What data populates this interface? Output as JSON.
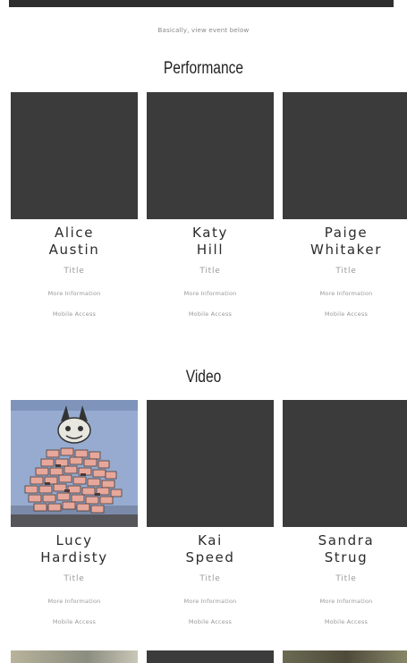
{
  "intro_text": "Basically, view event below",
  "sections": [
    {
      "title": "Performance",
      "artists": [
        {
          "first": "Alice",
          "last": "Austin",
          "title": "Title",
          "more": "More Information",
          "mobile": "Mobile Access"
        },
        {
          "first": "Katy",
          "last": "Hill",
          "title": "Title",
          "more": "More Information",
          "mobile": "Mobile Access"
        },
        {
          "first": "Paige",
          "last": "Whitaker",
          "title": "Title",
          "more": "More Information",
          "mobile": "Mobile Access"
        }
      ]
    },
    {
      "title": "Video",
      "artists": [
        {
          "first": "Lucy",
          "last": "Hardisty",
          "title": "Title",
          "more": "More Information",
          "mobile": "Mobile Access"
        },
        {
          "first": "Kai",
          "last": "Speed",
          "title": "Title",
          "more": "More Information",
          "mobile": "Mobile Access"
        },
        {
          "first": "Sandra",
          "last": "Strug",
          "title": "Title",
          "more": "More Information",
          "mobile": "Mobile Access"
        }
      ]
    }
  ],
  "colors": {
    "thumbnail_placeholder": "#3b3b3b",
    "top_bar": "#2e2e2e"
  }
}
